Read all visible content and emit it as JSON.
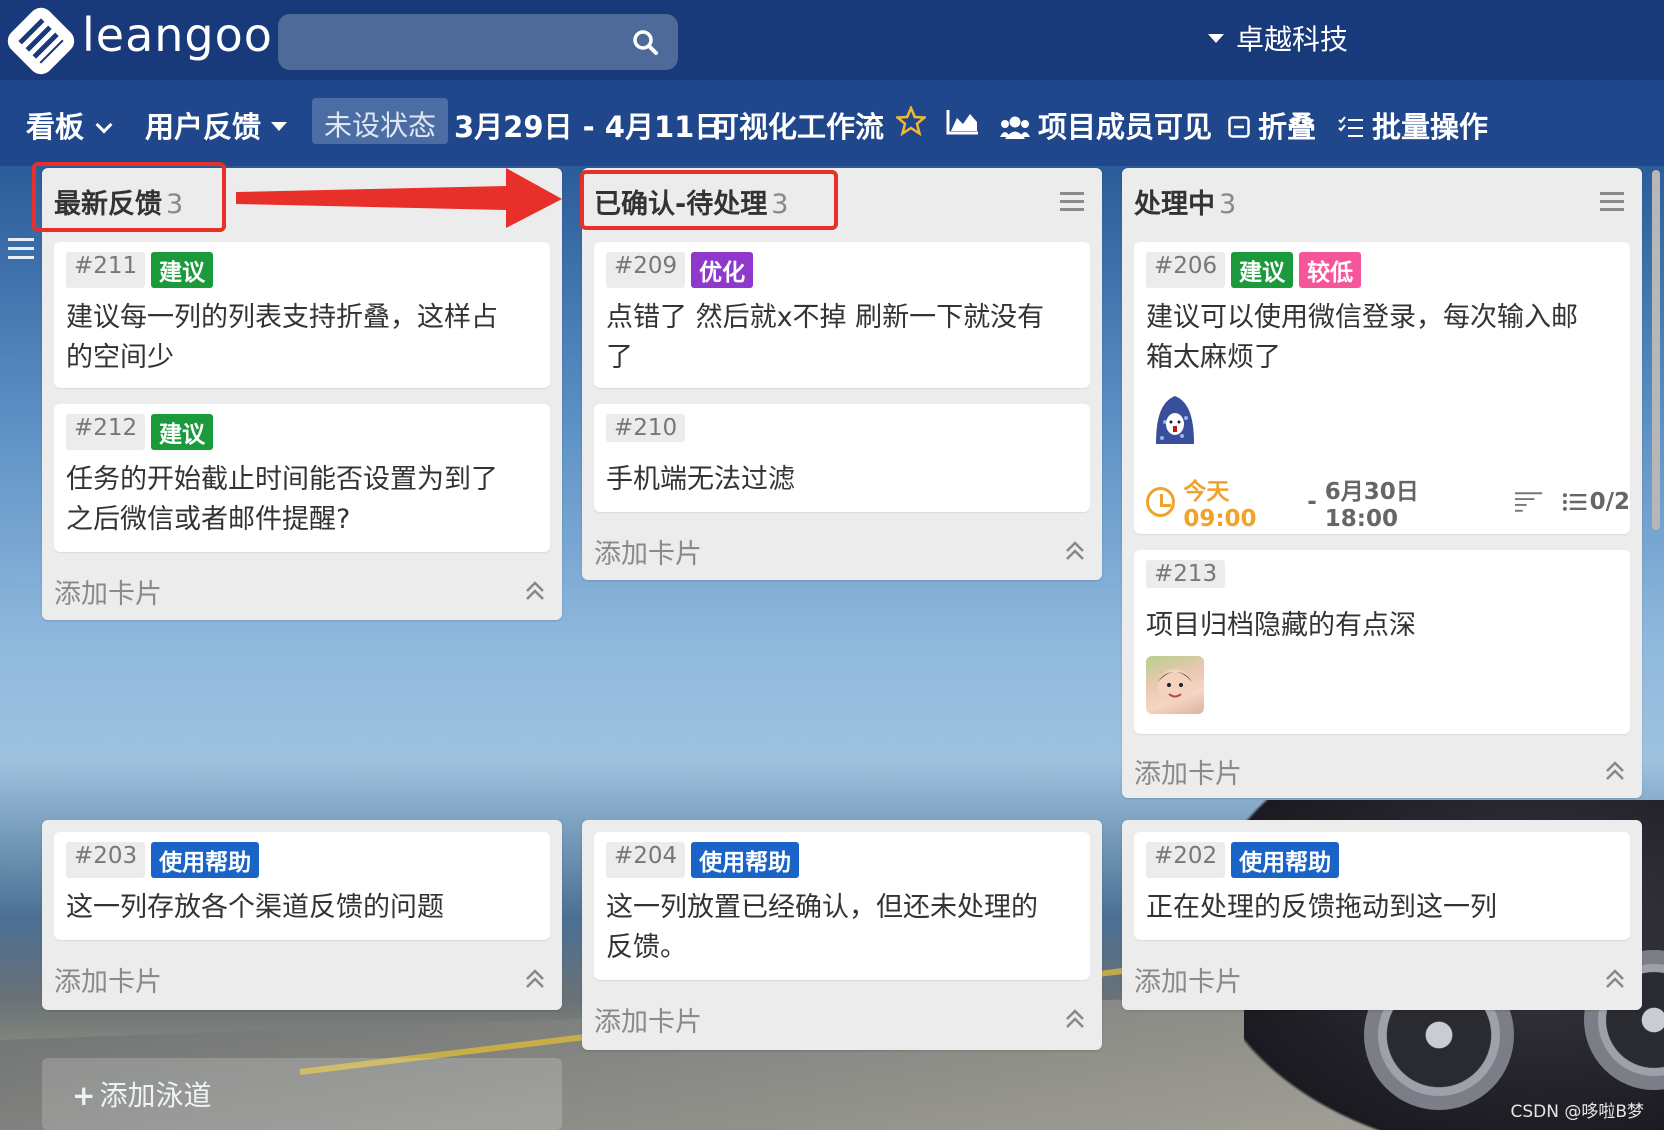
{
  "app": {
    "logo_text": "leangoo",
    "org": "卓越科技"
  },
  "toolbar": {
    "board_label": "看板",
    "board_name": "用户反馈",
    "status": "未设状态",
    "date_range": "3月29日 - 4月11日",
    "workflow": "可视化工作流",
    "visibility": "项目成员可见",
    "fold": "折叠",
    "batch": "批量操作"
  },
  "columns": [
    {
      "title": "最新反馈",
      "count": "3",
      "cards": [
        {
          "id": "#211",
          "tags": [
            "建议"
          ],
          "text": "建议每一列的列表支持折叠，这样占的空间少"
        },
        {
          "id": "#212",
          "tags": [
            "建议"
          ],
          "text": "任务的开始截止时间能否设置为到了之后微信或者邮件提醒?"
        }
      ],
      "add_card": "添加卡片"
    },
    {
      "title": "已确认-待处理",
      "count": "3",
      "cards": [
        {
          "id": "#209",
          "tags": [
            "优化"
          ],
          "text": "点错了 然后就x不掉 刷新一下就没有了"
        },
        {
          "id": "#210",
          "tags": [],
          "text": "手机端无法过滤"
        }
      ],
      "add_card": "添加卡片"
    },
    {
      "title": "处理中",
      "count": "3",
      "cards": [
        {
          "id": "#206",
          "tags": [
            "建议",
            "较低"
          ],
          "text": "建议可以使用微信登录，每次输入邮箱太麻烦了",
          "due_start": "今天09:00",
          "due_sep": "-",
          "due_end": "6月30日 18:00",
          "checklist": "0/2"
        },
        {
          "id": "#213",
          "tags": [],
          "text": "项目归档隐藏的有点深"
        }
      ],
      "add_card": "添加卡片"
    }
  ],
  "lane2": [
    {
      "id": "#203",
      "tag": "使用帮助",
      "text": "这一列存放各个渠道反馈的问题",
      "add_card": "添加卡片"
    },
    {
      "id": "#204",
      "tag": "使用帮助",
      "text": "这一列放置已经确认，但还未处理的反馈。",
      "add_card": "添加卡片"
    },
    {
      "id": "#202",
      "tag": "使用帮助",
      "text": "正在处理的反馈拖动到这一列",
      "add_card": "添加卡片"
    }
  ],
  "add_lane": "添加泳道",
  "watermark": "CSDN @哆啦B梦",
  "colors": {
    "green_tag": "#1a9a3a",
    "purple_tag": "#8e38cc",
    "pink_tag": "#f5569a",
    "blue_tag": "#1a64c8",
    "highlight": "#e8302a",
    "due": "#f0a32a",
    "header": "#18397a"
  }
}
